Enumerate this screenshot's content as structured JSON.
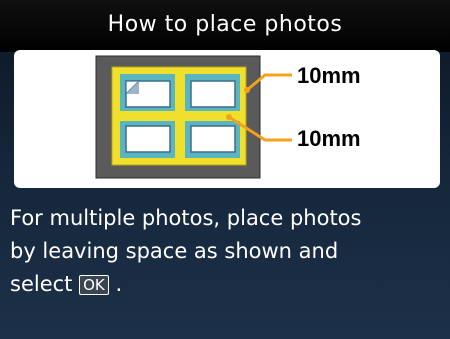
{
  "header": {
    "title": "How to place photos"
  },
  "diagram": {
    "callouts": [
      {
        "text": "10mm"
      },
      {
        "text": "10mm"
      }
    ]
  },
  "message": {
    "line1": "For multiple photos, place photos",
    "line2": "by leaving space as shown and",
    "line3_prefix": "select",
    "ok_key": "OK",
    "line3_suffix": "."
  },
  "colors": {
    "highlight": "#f0e02c",
    "callout_line": "#f3a21a",
    "platen": "#595959",
    "background": "#1c3049"
  }
}
